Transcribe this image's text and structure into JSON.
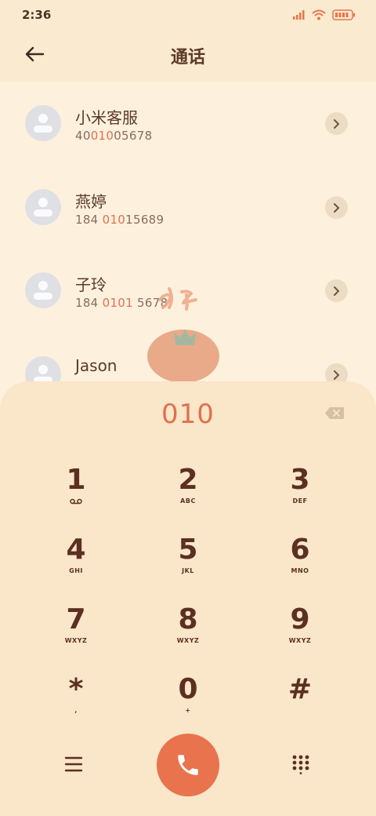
{
  "status_bar": {
    "time": "2:36"
  },
  "header": {
    "title": "通话"
  },
  "contacts": [
    {
      "name": "小米客服",
      "number_parts": [
        {
          "t": "40",
          "hl": false
        },
        {
          "t": "010",
          "hl": true
        },
        {
          "t": "05678",
          "hl": false
        }
      ]
    },
    {
      "name": "燕婷",
      "number_parts": [
        {
          "t": "184 ",
          "hl": false
        },
        {
          "t": "010",
          "hl": true
        },
        {
          "t": "15689",
          "hl": false
        }
      ]
    },
    {
      "name": "子玲",
      "number_parts": [
        {
          "t": "184 ",
          "hl": false
        },
        {
          "t": "0101",
          "hl": true
        },
        {
          "t": " 5678",
          "hl": false
        }
      ]
    },
    {
      "name": "Jason",
      "number_parts": []
    }
  ],
  "dialpad": {
    "input": "010",
    "keys": [
      {
        "digit": "1",
        "letters": ""
      },
      {
        "digit": "2",
        "letters": "ABC"
      },
      {
        "digit": "3",
        "letters": "DEF"
      },
      {
        "digit": "4",
        "letters": "GHI"
      },
      {
        "digit": "5",
        "letters": "JKL"
      },
      {
        "digit": "6",
        "letters": "MNO"
      },
      {
        "digit": "7",
        "letters": "WXYZ"
      },
      {
        "digit": "8",
        "letters": "WXYZ"
      },
      {
        "digit": "9",
        "letters": "WXYZ"
      },
      {
        "digit": "*",
        "letters": ","
      },
      {
        "digit": "0",
        "letters": "+"
      },
      {
        "digit": "#",
        "letters": ""
      }
    ]
  },
  "colors": {
    "accent": "#e8734d",
    "text": "#5b3a29",
    "background": "#fdf0dc"
  },
  "icons": [
    "signal-icon",
    "wifi-icon",
    "battery-icon",
    "back-arrow-icon",
    "chevron-right-icon",
    "backspace-icon",
    "voicemail-icon",
    "menu-icon",
    "phone-icon",
    "dialpad-grid-icon"
  ]
}
